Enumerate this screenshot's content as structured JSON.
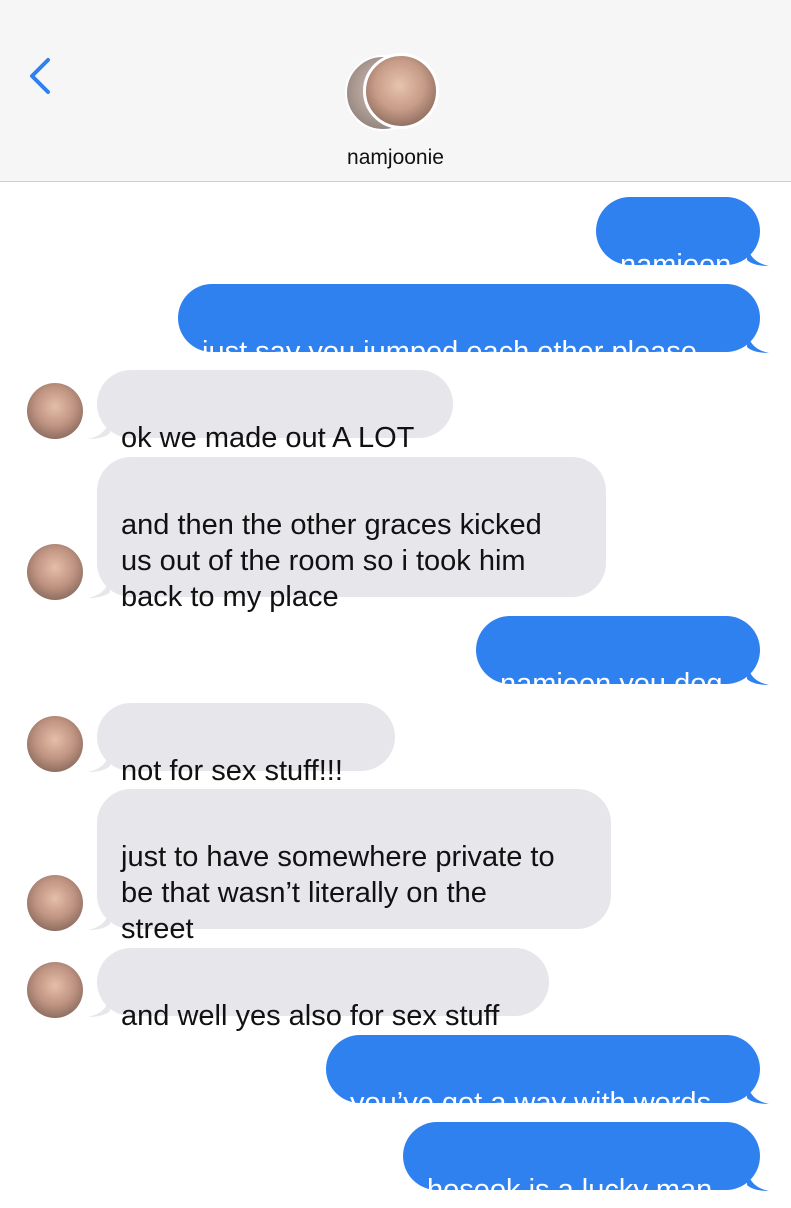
{
  "header": {
    "back_icon": "chevron-left-icon",
    "contact_name": "namjoonie",
    "accent_color": "#2f81ef"
  },
  "messages": [
    {
      "direction": "outgoing",
      "text": "namjoon"
    },
    {
      "direction": "outgoing",
      "text": "just say you jumped each other please"
    },
    {
      "direction": "incoming",
      "text": "ok we made out A LOT"
    },
    {
      "direction": "incoming",
      "text": "and then the other graces kicked\nus out of the room so i took him\nback to my place"
    },
    {
      "direction": "outgoing",
      "text": "namjoon you dog"
    },
    {
      "direction": "incoming",
      "text": "not for sex stuff!!!"
    },
    {
      "direction": "incoming",
      "text": "just to have somewhere private to\nbe that wasn’t literally on the\nstreet"
    },
    {
      "direction": "incoming",
      "text": "and well yes also for sex stuff"
    },
    {
      "direction": "outgoing",
      "text": "you’ve got a way with words"
    },
    {
      "direction": "outgoing",
      "text": "hoseok is a lucky man"
    }
  ]
}
